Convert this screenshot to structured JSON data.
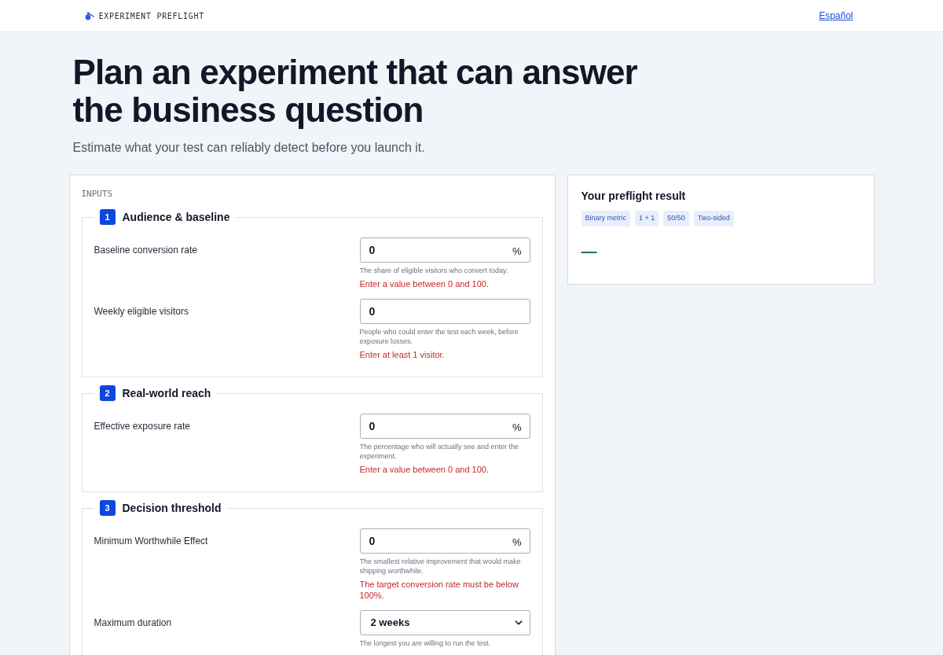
{
  "header": {
    "brand": "EXPERIMENT PREFLIGHT",
    "language_link": "Español"
  },
  "hero": {
    "title": "Plan an experiment that can answer the business question",
    "subtitle": "Estimate what your test can reliably detect before you launch it."
  },
  "inputs": {
    "heading": "INPUTS",
    "sections": [
      {
        "number": "1",
        "title": "Audience & baseline",
        "fields": [
          {
            "kind": "number",
            "label": "Baseline conversion rate",
            "value": "0",
            "unit": "%",
            "help": "The share of eligible visitors who convert today.",
            "error": "Enter a value between 0 and 100."
          },
          {
            "kind": "number",
            "label": "Weekly eligible visitors",
            "value": "0",
            "help": "People who could enter the test each week, before exposure losses.",
            "error": "Enter at least 1 visitor."
          }
        ]
      },
      {
        "number": "2",
        "title": "Real-world reach",
        "fields": [
          {
            "kind": "number",
            "label": "Effective exposure rate",
            "value": "0",
            "unit": "%",
            "help": "The percentage who will actually see and enter the experiment.",
            "error": "Enter a value between 0 and 100."
          }
        ]
      },
      {
        "number": "3",
        "title": "Decision threshold",
        "fields": [
          {
            "kind": "number",
            "label": "Minimum Worthwhile Effect",
            "value": "0",
            "unit": "%",
            "help": "The smallest relative improvement that would make shipping worthwhile.",
            "error": "The target conversion rate must be below 100%."
          },
          {
            "kind": "select",
            "label": "Maximum duration",
            "value": "2 weeks",
            "help": "The longest you are willing to run the test."
          }
        ]
      }
    ]
  },
  "result": {
    "title": "Your preflight result",
    "tags": [
      "Binary metric",
      "1 + 1",
      "50/50",
      "Two-sided"
    ],
    "value": "—"
  }
}
